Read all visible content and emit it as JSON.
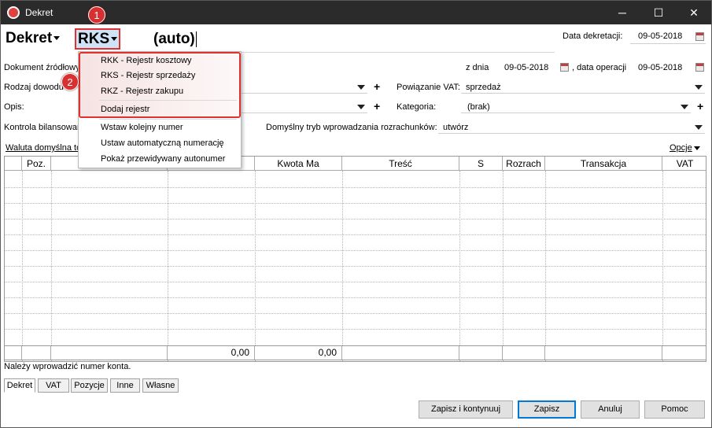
{
  "window": {
    "title": "Dekret",
    "minimize": "─",
    "maximize": "☐",
    "close": "✕"
  },
  "header": {
    "dekret_label": "Dekret",
    "register_code": "RKS",
    "number": "(auto)",
    "data_dekretacji_label": "Data dekretacji:",
    "data_dekretacji_value": "09-05-2018"
  },
  "form": {
    "dokument_zrodlowy_label": "Dokument źródłowy",
    "z_dnia_label": "z dnia",
    "z_dnia_value": "09-05-2018",
    "data_operacji_label": ", data operacji",
    "data_operacji_value": "09-05-2018",
    "rodzaj_dowodu_label": "Rodzaj dowodu",
    "powiazanie_vat_label": "Powiązanie VAT:",
    "powiazanie_vat_value": "sprzedaż",
    "opis_label": "Opis:",
    "kategoria_label": "Kategoria:",
    "kategoria_value": "(brak)",
    "kontrola_label": "Kontrola bilansowania",
    "domyslny_tryb_label": "Domyślny tryb wprowadzania rozrachunków:",
    "domyslny_tryb_value": "utwórz",
    "waluta_label": "Waluta domyślna to",
    "opcje_label": "Opcje"
  },
  "menu": {
    "items": [
      "RKK - Rejestr kosztowy",
      "RKS - Rejestr sprzedaży",
      "RKZ - Rejestr zakupu",
      "Dodaj rejestr",
      "Wstaw kolejny numer",
      "Ustaw automatyczną numerację",
      "Pokaż przewidywany autonumer"
    ]
  },
  "badges": {
    "one": "1",
    "two": "2"
  },
  "grid": {
    "columns": [
      "",
      "Poz.",
      "",
      "",
      "Kwota Ma",
      "Treść",
      "S",
      "Rozrach",
      "Transakcja",
      "VAT"
    ],
    "totals": {
      "wn": "0,00",
      "ma": "0,00"
    }
  },
  "status_text": "Należy wprowadzić numer konta.",
  "tabs": [
    "Dekret",
    "VAT",
    "Pozycje",
    "Inne",
    "Własne"
  ],
  "buttons": {
    "zapisz_kontynuuj": "Zapisz i kontynuuj",
    "zapisz": "Zapisz",
    "anuluj": "Anuluj",
    "pomoc": "Pomoc"
  },
  "colors": {
    "accent_red": "#e03030",
    "selection_blue": "#cfe3f7",
    "titlebar": "#2b2b2b"
  }
}
